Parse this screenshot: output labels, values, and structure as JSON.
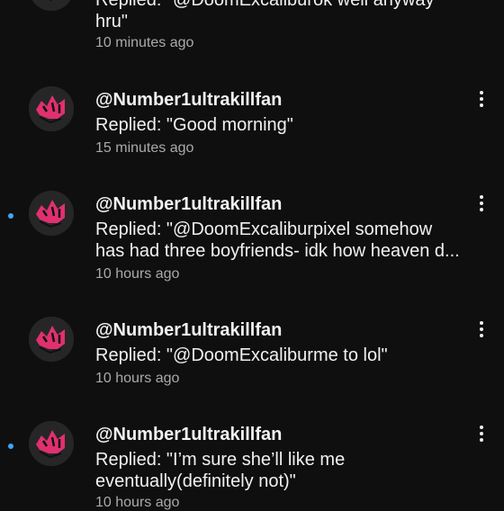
{
  "notifications": [
    {
      "handle": "",
      "lines": [
        "Replied: \"@DoomExcaliburok well anyway",
        "hru\""
      ],
      "time": "10 minutes ago",
      "unread": false
    },
    {
      "handle": "@Number1ultrakillfan",
      "lines": [
        "Replied: \"Good morning\""
      ],
      "time": "15 minutes ago",
      "unread": false
    },
    {
      "handle": "@Number1ultrakillfan",
      "lines": [
        "Replied: \"@DoomExcaliburpixel somehow",
        "has had three boyfriends- idk how heaven d..."
      ],
      "time": "10 hours ago",
      "unread": true
    },
    {
      "handle": "@Number1ultrakillfan",
      "lines": [
        "Replied: \"@DoomExcaliburme to lol\""
      ],
      "time": "10 hours ago",
      "unread": false
    },
    {
      "handle": "@Number1ultrakillfan",
      "lines": [
        "Replied: \"I’m sure she’ll like me",
        "eventually(definitely not)\""
      ],
      "time": "10 hours ago",
      "unread": true
    }
  ],
  "icons": {
    "more": "more-vert-icon",
    "unread": "unread-dot-icon"
  },
  "colors": {
    "background": "#0f0f0f",
    "text": "#f1f1f1",
    "secondary_text": "#aaaaaa",
    "unread_dot": "#3ea6ff",
    "avatar_accent": "#e0306f"
  }
}
